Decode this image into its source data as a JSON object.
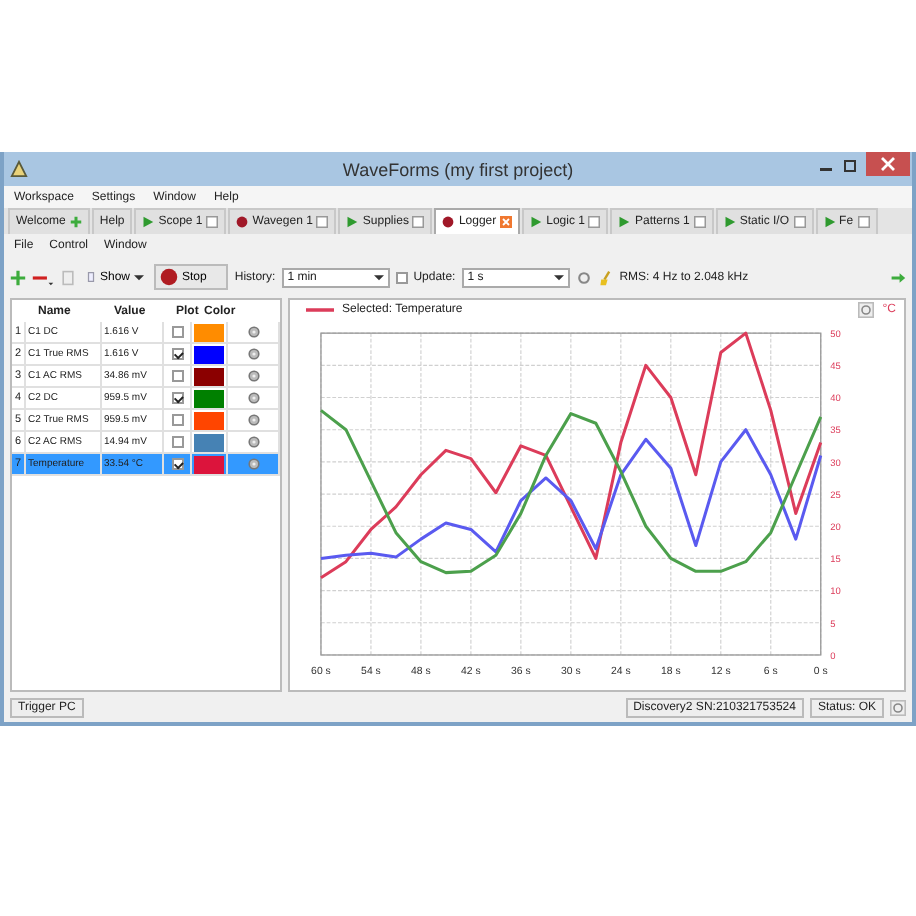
{
  "window": {
    "title": "WaveForms  (my first project)"
  },
  "menu": [
    "Workspace",
    "Settings",
    "Window",
    "Help"
  ],
  "tabs": [
    {
      "label": "Welcome",
      "kind": "add",
      "selected": false
    },
    {
      "label": "Help",
      "kind": "none",
      "selected": false
    },
    {
      "label": "Scope 1",
      "kind": "play",
      "selected": false
    },
    {
      "label": "Wavegen 1",
      "kind": "record",
      "selected": false
    },
    {
      "label": "Supplies",
      "kind": "play",
      "selected": false
    },
    {
      "label": "Logger",
      "kind": "record",
      "selected": true
    },
    {
      "label": "Logic 1",
      "kind": "play",
      "selected": false
    },
    {
      "label": "Patterns 1",
      "kind": "play",
      "selected": false
    },
    {
      "label": "Static I/O",
      "kind": "play",
      "selected": false
    },
    {
      "label": "Fe",
      "kind": "play",
      "selected": false
    }
  ],
  "submenu": [
    "File",
    "Control",
    "Window"
  ],
  "toolbar": {
    "show": "Show",
    "stop": "Stop",
    "history_label": "History:",
    "history": "1 min",
    "update_label": "Update:",
    "update_checked": false,
    "update": "1 s",
    "rms": "RMS: 4 Hz to 2.048 kHz"
  },
  "table": {
    "columns": [
      "Name",
      "Value",
      "Plot",
      "Color"
    ],
    "rows": [
      {
        "index": "1",
        "name": "C1 DC",
        "value": "1.616 V",
        "plot": false,
        "color": "#ff8c00",
        "selected": false
      },
      {
        "index": "2",
        "name": "C1 True RMS",
        "value": "1.616 V",
        "plot": true,
        "color": "#0000ff",
        "selected": false
      },
      {
        "index": "3",
        "name": "C1 AC RMS",
        "value": "34.86 mV",
        "plot": false,
        "color": "#8b0000",
        "selected": false
      },
      {
        "index": "4",
        "name": "C2 DC",
        "value": "959.5 mV",
        "plot": true,
        "color": "#008000",
        "selected": false
      },
      {
        "index": "5",
        "name": "C2 True RMS",
        "value": "959.5 mV",
        "plot": false,
        "color": "#ff4500",
        "selected": false
      },
      {
        "index": "6",
        "name": "C2 AC RMS",
        "value": "14.94 mV",
        "plot": false,
        "color": "#4682b4",
        "selected": false
      },
      {
        "index": "7",
        "name": "Temperature",
        "value": "33.54 °C",
        "plot": true,
        "color": "#dc143c",
        "selected": true
      }
    ]
  },
  "chart": {
    "legend": "Selected: Temperature",
    "unit": "°C",
    "chart_data": {
      "type": "line",
      "x": [
        -60,
        -57,
        -54,
        -51,
        -48,
        -45,
        -42,
        -39,
        -36,
        -33,
        -30,
        -27,
        -24,
        -21,
        -18,
        -15,
        -12,
        -9,
        -6,
        -3,
        0
      ],
      "series": [
        {
          "color": "#dc3c5a",
          "values": [
            12,
            14.5,
            19.5,
            23,
            28,
            31.8,
            30.5,
            25.2,
            32.5,
            31,
            23,
            15,
            33,
            45,
            40,
            28,
            47,
            50,
            38,
            22,
            33
          ]
        },
        {
          "color": "#5a5af0",
          "values": [
            15,
            15.5,
            15.8,
            15.2,
            18,
            20.5,
            19.5,
            16,
            24,
            27.5,
            24,
            16.5,
            28,
            33.5,
            29,
            17,
            30,
            35,
            28,
            18,
            31
          ]
        },
        {
          "color": "#4ca04c",
          "values": [
            38,
            35,
            27,
            19,
            14.5,
            12.8,
            13,
            15.5,
            22,
            31,
            37.5,
            36,
            28.5,
            20,
            15,
            13,
            13,
            14.5,
            19,
            28,
            37
          ]
        }
      ],
      "grid": true,
      "xlim": [
        -60,
        0
      ],
      "ylim": [
        0,
        50
      ],
      "xticks": [
        {
          "value": -60,
          "label": "60 s"
        },
        {
          "value": -54,
          "label": "54 s"
        },
        {
          "value": -48,
          "label": "48 s"
        },
        {
          "value": -42,
          "label": "42 s"
        },
        {
          "value": -36,
          "label": "36 s"
        },
        {
          "value": -30,
          "label": "30 s"
        },
        {
          "value": -24,
          "label": "24 s"
        },
        {
          "value": -18,
          "label": "18 s"
        },
        {
          "value": -12,
          "label": "12 s"
        },
        {
          "value": -6,
          "label": "6 s"
        },
        {
          "value": 0,
          "label": "0 s"
        }
      ],
      "yticks": [
        0,
        5,
        10,
        15,
        20,
        25,
        30,
        35,
        40,
        45,
        50
      ]
    }
  },
  "status": {
    "trigger": "Trigger PC",
    "device": "Discovery2 SN:210321753524",
    "state": "Status: OK"
  }
}
